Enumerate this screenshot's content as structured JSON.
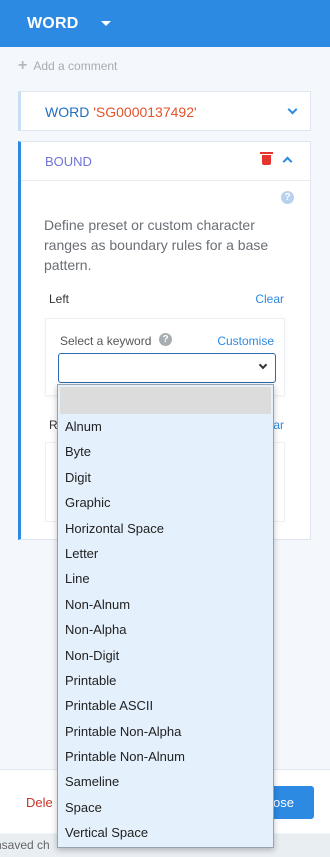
{
  "header": {
    "title": "WORD"
  },
  "add_comment": "Add a comment",
  "word_card": {
    "label": "WORD",
    "value": "'SG0000137492'"
  },
  "bound": {
    "title": "BOUND",
    "description": "Define preset or custom character ranges as boundary rules for a base pattern.",
    "left_label": "Left",
    "left_clear": "Clear",
    "keyword_label": "Select a keyword",
    "customise": "Customise",
    "right_label": "R",
    "right_clear": "ear"
  },
  "dropdown": {
    "options": [
      "Alnum",
      "Byte",
      "Digit",
      "Graphic",
      "Horizontal Space",
      "Letter",
      "Line",
      "Non-Alnum",
      "Non-Alpha",
      "Non-Digit",
      "Printable",
      "Printable ASCII",
      "Printable Non-Alpha",
      "Printable Non-Alnum",
      "Sameline",
      "Space",
      "Vertical Space"
    ]
  },
  "footer": {
    "delete": "Dele",
    "close": "ose"
  },
  "status": "nsaved ch",
  "colors": {
    "accent": "#2d8ae2",
    "danger": "#e6342e",
    "value": "#e5532b",
    "bound_title": "#6f74d6"
  }
}
